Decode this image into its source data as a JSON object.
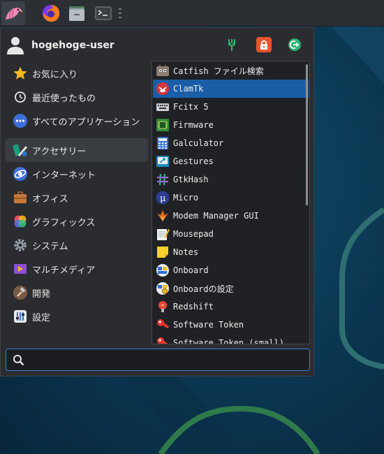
{
  "user": {
    "name": "hogehoge-user"
  },
  "panel": {
    "items": [
      {
        "name": "whisker-menu-button",
        "icon": "bird-icon"
      },
      {
        "name": "firefox-launcher",
        "icon": "firefox-icon"
      },
      {
        "name": "file-manager-launcher",
        "icon": "folder-icon"
      },
      {
        "name": "terminal-launcher",
        "icon": "terminal-icon"
      }
    ]
  },
  "actions": [
    {
      "name": "settings-manager",
      "icon": "settings-icon",
      "color": "#2bb673"
    },
    {
      "name": "lock-screen",
      "icon": "lock-icon",
      "color": "#e8552f"
    },
    {
      "name": "log-out",
      "icon": "logout-icon",
      "color": "#2bb673"
    }
  ],
  "categories": [
    {
      "label": "お気に入り",
      "icon": "star-icon",
      "active": false
    },
    {
      "label": "最近使ったもの",
      "icon": "clock-icon",
      "active": false
    },
    {
      "label": "すべてのアプリケーション",
      "icon": "dots-icon",
      "active": false
    },
    {
      "label": "アクセサリー",
      "icon": "accessories-icon",
      "active": true
    },
    {
      "label": "インターネット",
      "icon": "globe-icon",
      "active": false
    },
    {
      "label": "オフィス",
      "icon": "briefcase-icon",
      "active": false
    },
    {
      "label": "グラフィックス",
      "icon": "graphics-icon",
      "active": false
    },
    {
      "label": "システム",
      "icon": "gear-icon",
      "active": false
    },
    {
      "label": "マルチメディア",
      "icon": "multimedia-icon",
      "active": false
    },
    {
      "label": "開発",
      "icon": "hammer-icon",
      "active": false
    },
    {
      "label": "設定",
      "icon": "settings-panel-icon",
      "active": false
    }
  ],
  "apps": [
    {
      "label": "Catfish ファイル検索",
      "icon": "catfish-icon",
      "selected": false
    },
    {
      "label": "ClamTk",
      "icon": "clamtk-icon",
      "selected": true
    },
    {
      "label": "Fcitx 5",
      "icon": "keyboard-icon",
      "selected": false
    },
    {
      "label": "Firmware",
      "icon": "chip-icon",
      "selected": false
    },
    {
      "label": "Galculator",
      "icon": "calculator-icon",
      "selected": false
    },
    {
      "label": "Gestures",
      "icon": "gestures-icon",
      "selected": false
    },
    {
      "label": "GtkHash",
      "icon": "hash-icon",
      "selected": false
    },
    {
      "label": "Micro",
      "icon": "micro-icon",
      "selected": false
    },
    {
      "label": "Modem Manager GUI",
      "icon": "modem-icon",
      "selected": false
    },
    {
      "label": "Mousepad",
      "icon": "mousepad-icon",
      "selected": false
    },
    {
      "label": "Notes",
      "icon": "notes-icon",
      "selected": false
    },
    {
      "label": "Onboard",
      "icon": "onboard-icon",
      "selected": false
    },
    {
      "label": "Onboardの設定",
      "icon": "onboard-settings-icon",
      "selected": false
    },
    {
      "label": "Redshift",
      "icon": "redshift-icon",
      "selected": false
    },
    {
      "label": "Software Token",
      "icon": "token-icon",
      "selected": false
    },
    {
      "label": "Software Token (small)",
      "icon": "token-small-icon",
      "selected": false
    }
  ],
  "search": {
    "value": "",
    "placeholder": ""
  }
}
